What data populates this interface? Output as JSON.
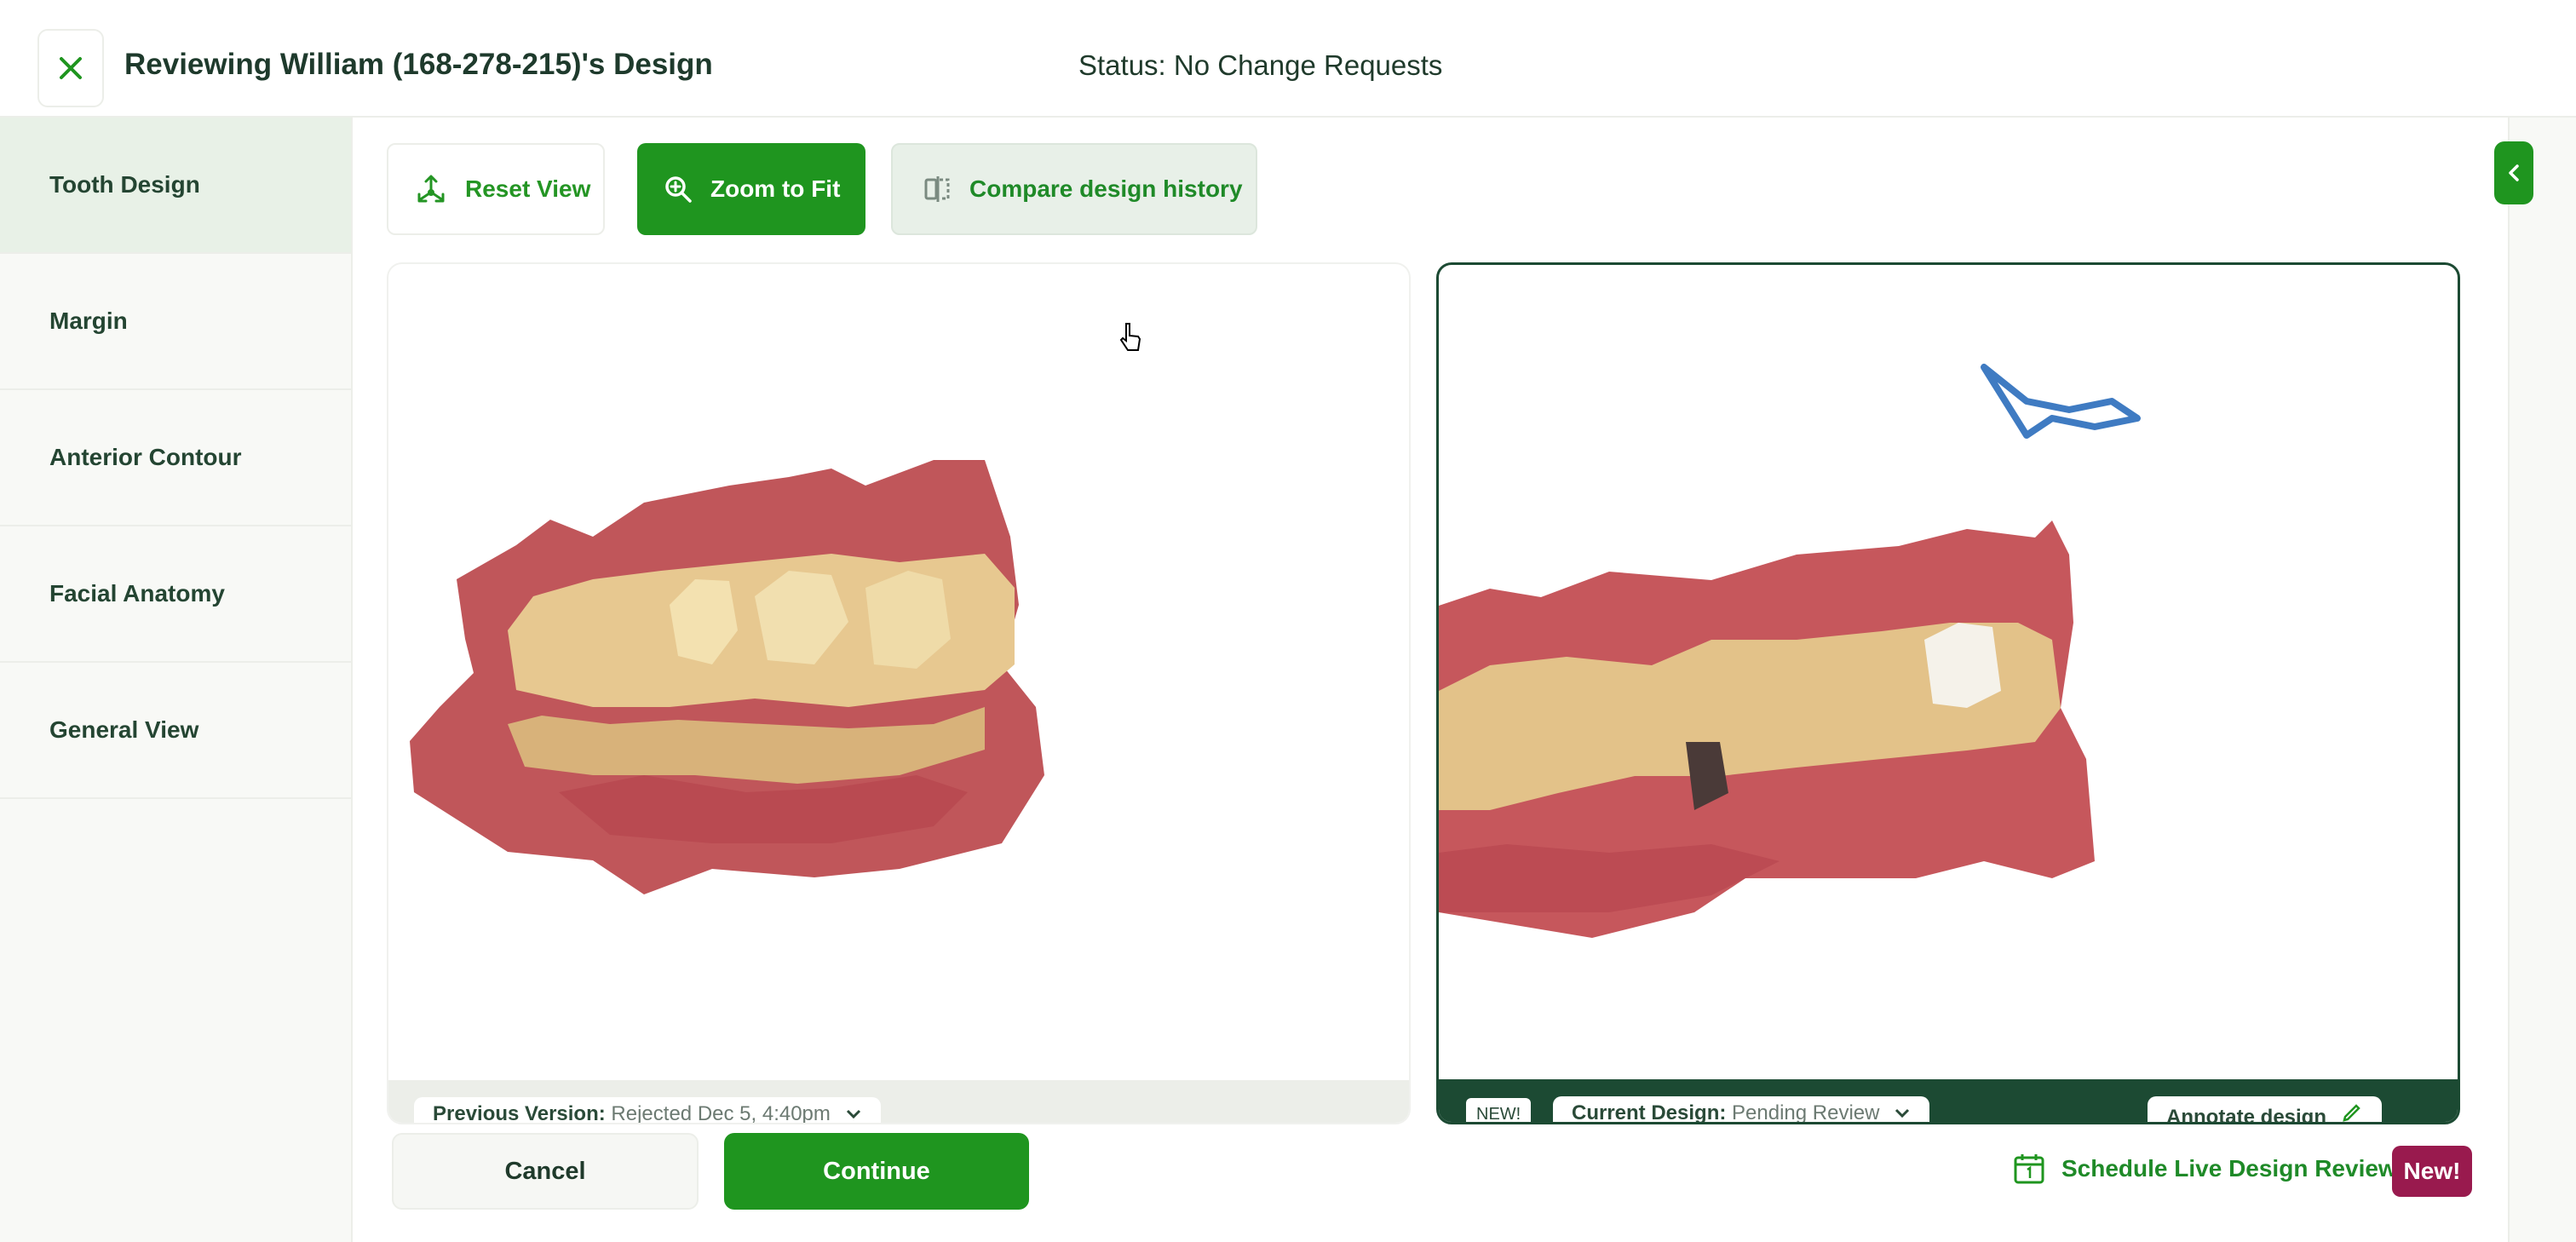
{
  "header": {
    "title": "Reviewing William (168-278-215)'s Design",
    "status": "Status: No Change Requests",
    "close_icon": "close-icon"
  },
  "sidebar": {
    "items": [
      {
        "label": "Tooth Design",
        "active": true
      },
      {
        "label": "Margin",
        "active": false
      },
      {
        "label": "Anterior Contour",
        "active": false
      },
      {
        "label": "Facial Anatomy",
        "active": false
      },
      {
        "label": "General View",
        "active": false
      }
    ]
  },
  "toolbar": {
    "reset_label": "Reset View",
    "zoom_label": "Zoom to Fit",
    "compare_label": "Compare design history"
  },
  "viewer_left": {
    "version_label": "Previous Version:",
    "version_value": "Rejected Dec 5, 4:40pm"
  },
  "viewer_right": {
    "new_tag": "NEW!",
    "version_label": "Current Design:",
    "version_value": "Pending Review",
    "annotate_label": "Annotate design"
  },
  "footer": {
    "cancel_label": "Cancel",
    "continue_label": "Continue",
    "schedule_label": "Schedule Live Design Review",
    "new_badge": "New!"
  },
  "colors": {
    "accent": "#1f951f",
    "dark_green": "#1c4a33",
    "badge": "#991a4e"
  }
}
